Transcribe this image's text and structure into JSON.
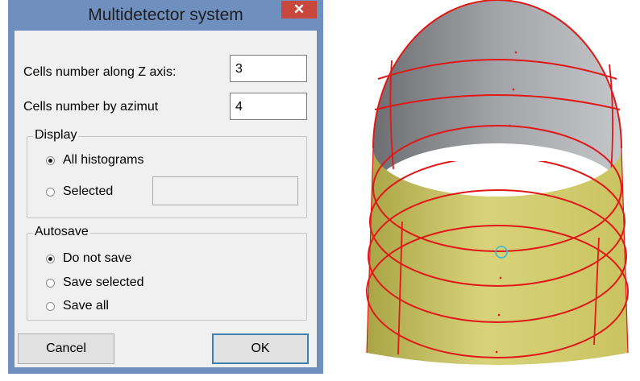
{
  "dialog": {
    "title": "Multidetector system",
    "close_symbol": "✕",
    "cells_z_label": "Cells number along Z axis:",
    "cells_z_value": "3",
    "cells_azimut_label": "Cells number by azimut",
    "cells_azimut_value": "4",
    "display": {
      "title": "Display",
      "options": [
        "All histograms",
        "Selected"
      ],
      "selected": "All histograms"
    },
    "autosave": {
      "title": "Autosave",
      "options": [
        "Do not save",
        "Save selected",
        "Save all"
      ],
      "selected": "Do not save"
    },
    "cancel_label": "Cancel",
    "ok_label": "OK"
  },
  "viewport": {
    "object": "cylinder-detector",
    "outer_color": "#cfc96a",
    "inner_color": "#8d8f93",
    "grid_color": "#e01818",
    "marker_color": "#35b8d8"
  }
}
